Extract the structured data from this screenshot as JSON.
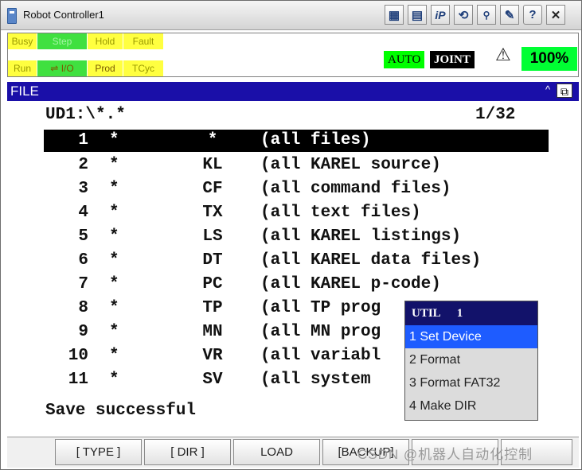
{
  "window": {
    "title": "Robot Controller1"
  },
  "toolbar": {
    "icons": [
      "keypad-icon",
      "list-icon",
      "ipendant-icon",
      "refresh-icon",
      "dial-icon",
      "edit-icon",
      "help-icon",
      "close-icon"
    ],
    "iP": "iP",
    "close": "✕",
    "help": "?"
  },
  "status": {
    "leds": [
      "Busy",
      "Step",
      "Hold",
      "Fault",
      "Run",
      "I/O",
      "Prod",
      "TCyc"
    ],
    "mode": "AUTO",
    "coord": "JOINT",
    "override": "100%"
  },
  "file_header": {
    "title": "FILE",
    "caret": "^",
    "window_icon": "⧉"
  },
  "file": {
    "path": "UD1:\\*.*",
    "page": "1/32",
    "rows": [
      {
        "num": "1",
        "star": "*",
        "ext": "*",
        "desc": "(all files)"
      },
      {
        "num": "2",
        "star": "*",
        "ext": "KL",
        "desc": "(all KAREL source)"
      },
      {
        "num": "3",
        "star": "*",
        "ext": "CF",
        "desc": "(all command files)"
      },
      {
        "num": "4",
        "star": "*",
        "ext": "TX",
        "desc": "(all text files)"
      },
      {
        "num": "5",
        "star": "*",
        "ext": "LS",
        "desc": "(all KAREL listings)"
      },
      {
        "num": "6",
        "star": "*",
        "ext": "DT",
        "desc": "(all KAREL data files)"
      },
      {
        "num": "7",
        "star": "*",
        "ext": "PC",
        "desc": "(all KAREL p-code)"
      },
      {
        "num": "8",
        "star": "*",
        "ext": "TP",
        "desc": "(all TP prog"
      },
      {
        "num": "9",
        "star": "*",
        "ext": "MN",
        "desc": "(all MN prog"
      },
      {
        "num": "10",
        "star": "*",
        "ext": "VR",
        "desc": "(all variabl"
      },
      {
        "num": "11",
        "star": "*",
        "ext": "SV",
        "desc": "(all system"
      }
    ],
    "message": "Save successful"
  },
  "popup": {
    "title": "UTIL",
    "index": "1",
    "items": [
      "1 Set Device",
      "2 Format",
      "3 Format FAT32",
      "4 Make DIR"
    ]
  },
  "fkeys": [
    "[ TYPE ]",
    "[ DIR ]",
    "LOAD",
    "[BACKUP]"
  ],
  "watermark": "CSDN @机器人自动化控制"
}
